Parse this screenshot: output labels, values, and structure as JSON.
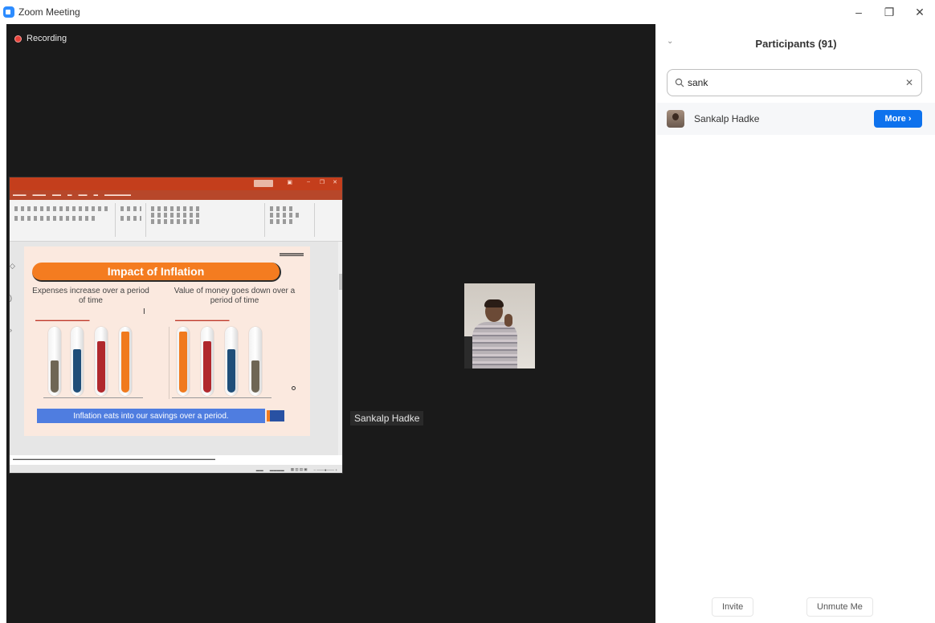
{
  "window": {
    "title": "Zoom Meeting",
    "controls": {
      "minimize": "–",
      "restore": "❐",
      "close": "✕"
    }
  },
  "meeting": {
    "recording_label": "Recording",
    "participant_name_tag": "Sankalp Hadke",
    "shared_screen": {
      "slide": {
        "banner": "Impact of Inflation",
        "left_title": "Expenses increase over a period of time",
        "right_title": "Value of money goes down over a period of time",
        "footer": "Inflation eats into our savings over a period."
      }
    }
  },
  "panel": {
    "title": "Participants (91)",
    "search": {
      "value": "sank"
    },
    "participants": [
      {
        "name": "Sankalp Hadke",
        "action_label": "More ›"
      }
    ],
    "footer": {
      "invite_label": "Invite",
      "unmute_label": "Unmute Me"
    }
  },
  "colors": {
    "zoom_blue": "#0e72ed",
    "recording_red": "#e8423b",
    "meeting_bg": "#1a1a1a",
    "ppt_orange": "#c43e1c",
    "slide_orange": "#f47c20",
    "slide_blue": "#4f7de0"
  }
}
